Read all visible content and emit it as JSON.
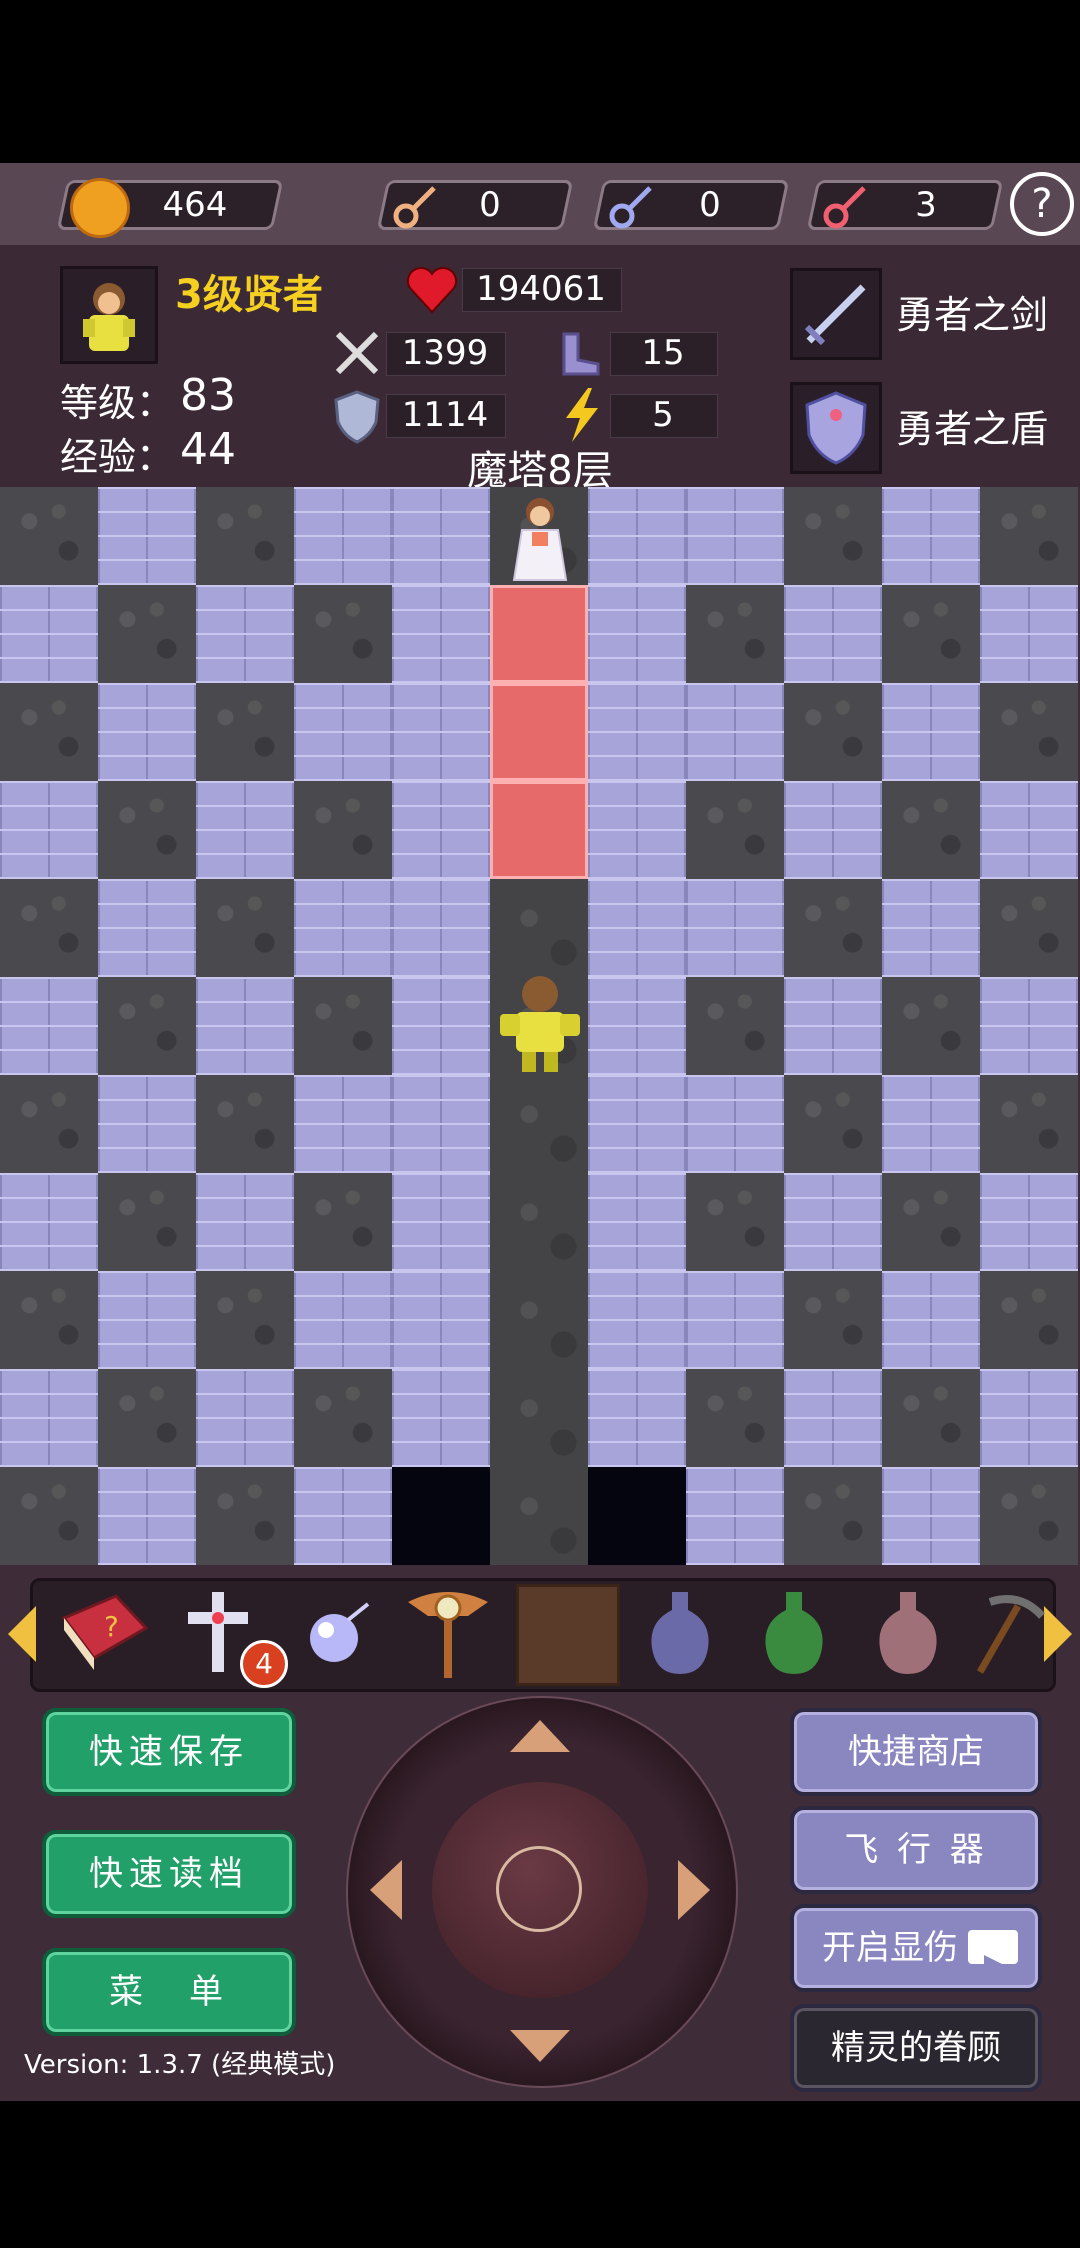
{
  "resources": {
    "gold": "464",
    "yellow_key": "0",
    "blue_key": "0",
    "red_key": "3",
    "help": "?"
  },
  "hero": {
    "title": "3级贤者",
    "level_label": "等级：",
    "level_value": "83",
    "exp_label": "经验：",
    "exp_value": "44",
    "hp": "194061",
    "attack": "1399",
    "defense": "1114",
    "speed": "15",
    "magic": "5"
  },
  "equipment": {
    "weapon": "勇者之剑",
    "shield": "勇者之盾"
  },
  "floor_title": "魔塔8层",
  "map": {
    "rows": [
      "WFWFFPFFWFW",
      "FWFWFDFWFWF",
      "WFWFFDFFWFW",
      "FWFWFDFWFWF",
      "WFWFFPFFWFW",
      "FWFWFPFWFWF",
      "WFWFFPFFWFW",
      "FWFWFPFWFWF",
      "WFWFFPFFWFW",
      "FWFWFPFWFWF",
      "WFWFSPSFWFW"
    ]
  },
  "item_bar": {
    "badge_count": "4",
    "items": [
      "monster-book",
      "holy-cross",
      "crystal-orb",
      "flying-wand",
      "door-key-item",
      "blue-potion",
      "green-potion",
      "pink-potion",
      "pickaxe"
    ]
  },
  "buttons": {
    "quick_save": "快速保存",
    "quick_load": "快速读档",
    "menu": "菜　单",
    "quick_shop": "快捷商店",
    "flyer": "飞 行 器",
    "show_damage": "开启显伤",
    "spirit": "精灵的眷顾"
  },
  "version": "Version: 1.3.7 (经典模式)"
}
